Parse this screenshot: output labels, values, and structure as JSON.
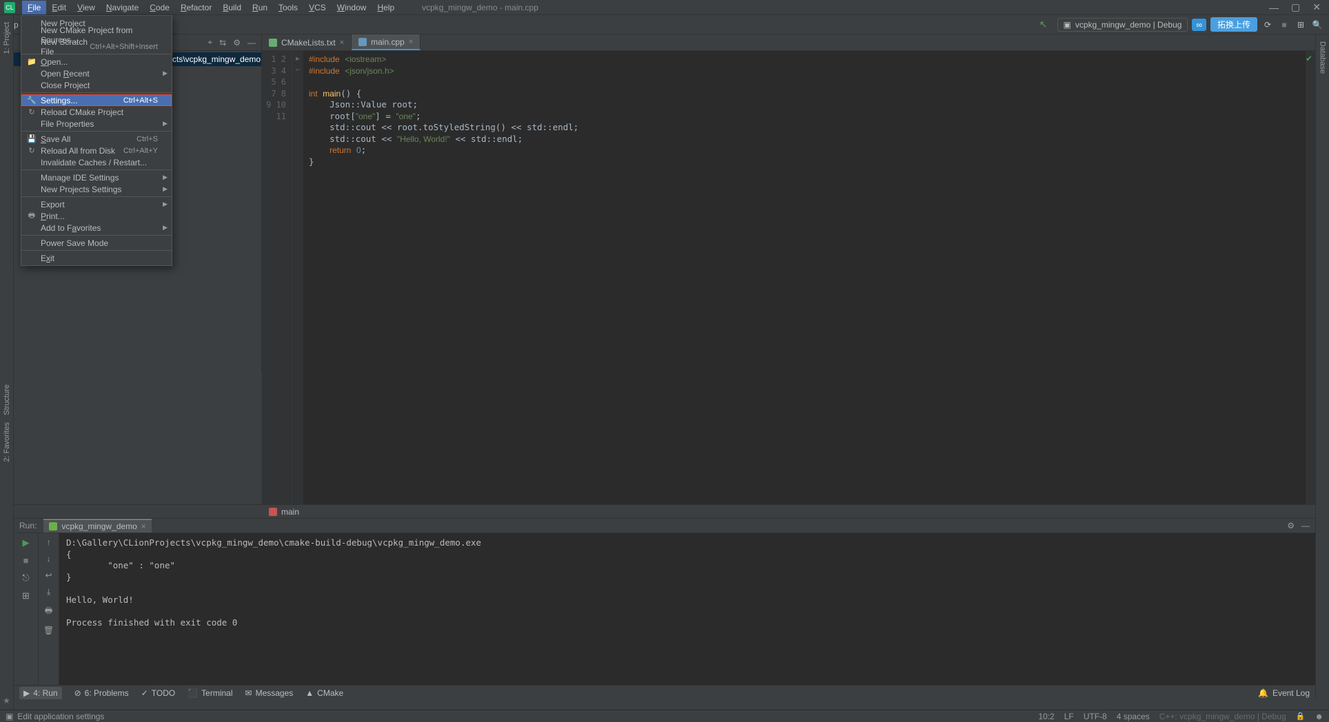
{
  "window": {
    "title": "vcpkg_mingw_demo - main.cpp"
  },
  "menubar": [
    "File",
    "Edit",
    "View",
    "Navigate",
    "Code",
    "Refactor",
    "Build",
    "Run",
    "Tools",
    "VCS",
    "Window",
    "Help"
  ],
  "menubar_active_index": 0,
  "toolbar": {
    "project_root_label": "vcp",
    "run_config": "vcpkg_mingw_demo | Debug",
    "upload_btn": "拓换上传"
  },
  "file_menu": [
    {
      "label": "New Project"
    },
    {
      "label": "New CMake Project from Sources..."
    },
    {
      "label": "New Scratch File",
      "shortcut": "Ctrl+Alt+Shift+Insert"
    },
    {
      "sep": true
    },
    {
      "label": "Open...",
      "icon": "folder",
      "ul": 0
    },
    {
      "label": "Open Recent",
      "submenu": true,
      "ul": 5
    },
    {
      "label": "Close Project",
      "ul": 9
    },
    {
      "sep": true
    },
    {
      "label": "Settings...",
      "shortcut": "Ctrl+Alt+S",
      "icon": "wrench",
      "highlight": true
    },
    {
      "label": "Reload CMake Project",
      "icon": "reload"
    },
    {
      "label": "File Properties",
      "submenu": true
    },
    {
      "sep": true
    },
    {
      "label": "Save All",
      "shortcut": "Ctrl+S",
      "icon": "save",
      "ul": 0
    },
    {
      "label": "Reload All from Disk",
      "shortcut": "Ctrl+Alt+Y",
      "icon": "reload"
    },
    {
      "label": "Invalidate Caches / Restart..."
    },
    {
      "sep": true
    },
    {
      "label": "Manage IDE Settings",
      "submenu": true
    },
    {
      "label": "New Projects Settings",
      "submenu": true
    },
    {
      "sep": true
    },
    {
      "label": "Export",
      "submenu": true
    },
    {
      "label": "Print...",
      "icon": "print",
      "ul": 0
    },
    {
      "label": "Add to Favorites",
      "submenu": true,
      "ul": 8
    },
    {
      "sep": true
    },
    {
      "label": "Power Save Mode"
    },
    {
      "sep": true
    },
    {
      "label": "Exit",
      "ul": 1
    }
  ],
  "sidebar": {
    "left_labels": [
      "1: Project",
      "2: Favorites",
      "Structure"
    ],
    "right_labels": [
      "Database"
    ],
    "selected_path_tail": "cts\\vcpkg_mingw_demo"
  },
  "tabs": [
    {
      "label": "CMakeLists.txt",
      "kind": "cmake"
    },
    {
      "label": "main.cpp",
      "kind": "cpp",
      "active": true
    }
  ],
  "editor": {
    "line_count": 11,
    "code_html": "<span class='inc'>#include</span> <span class='incf'>&lt;iostream&gt;</span>\n<span class='inc'>#include</span> <span class='incf'>&lt;json/json.h&gt;</span>\n\n<span class='kw'>int</span> <span class='fn'>main</span>() {\n    Json::Value root;\n    root[<span class='str'>\"one\"</span>] = <span class='str'>\"one\"</span>;\n    std::cout &lt;&lt; root.toStyledString() &lt;&lt; std::endl;\n    std::cout &lt;&lt; <span class='str'>\"Hello, World!\"</span> &lt;&lt; std::endl;\n    <span class='kw'>return</span> <span class='num'>0</span>;\n}\n"
  },
  "breadcrumb": {
    "fn": "main"
  },
  "run_panel": {
    "header_label": "Run:",
    "tab_label": "vcpkg_mingw_demo",
    "output": "D:\\Gallery\\CLionProjects\\vcpkg_mingw_demo\\cmake-build-debug\\vcpkg_mingw_demo.exe\n{\n        \"one\" : \"one\"\n}\n\nHello, World!\n\nProcess finished with exit code 0\n"
  },
  "bottom_tools": [
    {
      "label": "4: Run",
      "icon": "▶",
      "active": true
    },
    {
      "label": "6: Problems",
      "icon": "⊘"
    },
    {
      "label": "TODO",
      "icon": "✓"
    },
    {
      "label": "Terminal",
      "icon": "⬛"
    },
    {
      "label": "Messages",
      "icon": "✉"
    },
    {
      "label": "CMake",
      "icon": "▲"
    }
  ],
  "bottom_right": "Event Log",
  "statusbar": {
    "left": "Edit application settings",
    "pos": "10:2",
    "lineend": "LF",
    "encoding": "UTF-8",
    "indent": "4 spaces",
    "context": "C++: vcpkg_mingw_demo | Debug"
  }
}
